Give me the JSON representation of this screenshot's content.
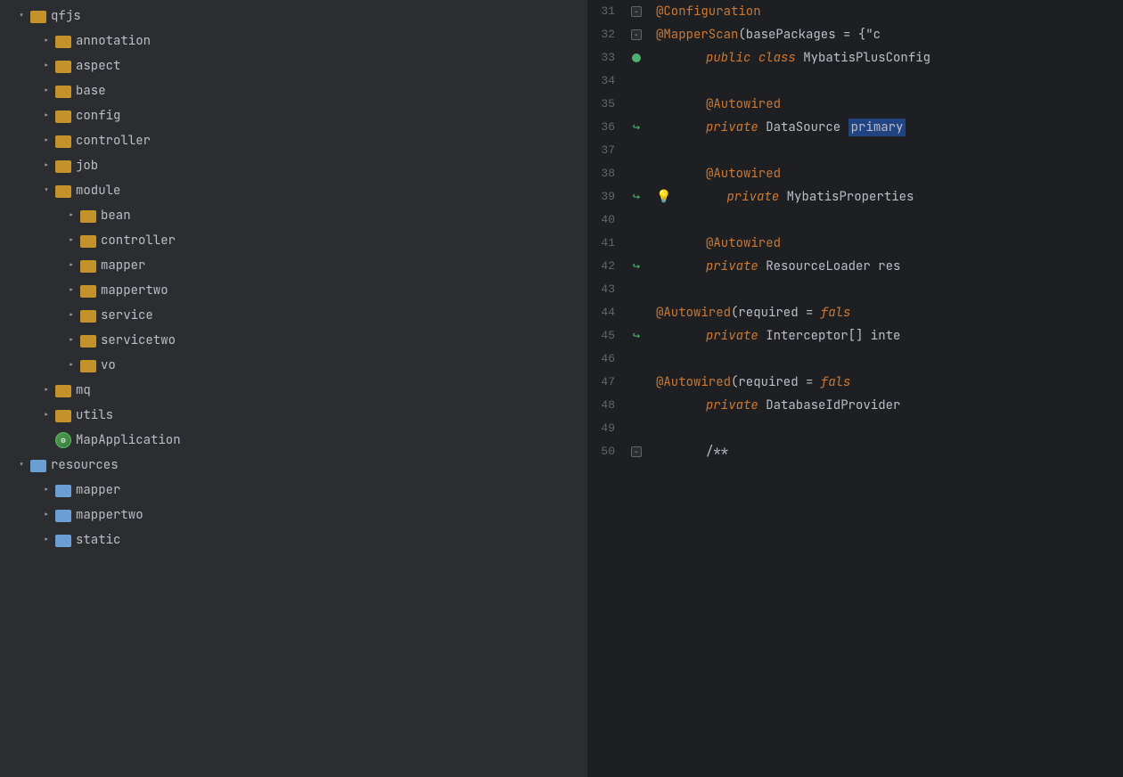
{
  "tree": {
    "items": [
      {
        "id": "qfjs",
        "label": "qfjs",
        "indent": 0,
        "chevron": "down",
        "icon": "folder",
        "level": 0
      },
      {
        "id": "annotation",
        "label": "annotation",
        "indent": 1,
        "chevron": "right",
        "icon": "folder",
        "level": 1
      },
      {
        "id": "aspect",
        "label": "aspect",
        "indent": 1,
        "chevron": "right",
        "icon": "folder",
        "level": 1
      },
      {
        "id": "base",
        "label": "base",
        "indent": 1,
        "chevron": "right",
        "icon": "folder",
        "level": 1
      },
      {
        "id": "config",
        "label": "config",
        "indent": 1,
        "chevron": "right",
        "icon": "folder",
        "level": 1
      },
      {
        "id": "controller",
        "label": "controller",
        "indent": 1,
        "chevron": "right",
        "icon": "folder",
        "level": 1
      },
      {
        "id": "job",
        "label": "job",
        "indent": 1,
        "chevron": "right",
        "icon": "folder",
        "level": 1
      },
      {
        "id": "module",
        "label": "module",
        "indent": 1,
        "chevron": "down",
        "icon": "folder",
        "level": 1
      },
      {
        "id": "bean",
        "label": "bean",
        "indent": 2,
        "chevron": "right",
        "icon": "folder",
        "level": 2
      },
      {
        "id": "m-controller",
        "label": "controller",
        "indent": 2,
        "chevron": "right",
        "icon": "folder",
        "level": 2
      },
      {
        "id": "mapper",
        "label": "mapper",
        "indent": 2,
        "chevron": "right",
        "icon": "folder",
        "level": 2
      },
      {
        "id": "mappertwo",
        "label": "mappertwo",
        "indent": 2,
        "chevron": "right",
        "icon": "folder",
        "level": 2
      },
      {
        "id": "service",
        "label": "service",
        "indent": 2,
        "chevron": "right",
        "icon": "folder",
        "level": 2
      },
      {
        "id": "servicetwo",
        "label": "servicetwo",
        "indent": 2,
        "chevron": "right",
        "icon": "folder",
        "level": 2
      },
      {
        "id": "vo",
        "label": "vo",
        "indent": 2,
        "chevron": "right",
        "icon": "folder",
        "level": 2
      },
      {
        "id": "mq",
        "label": "mq",
        "indent": 1,
        "chevron": "right",
        "icon": "folder",
        "level": 1
      },
      {
        "id": "utils",
        "label": "utils",
        "indent": 1,
        "chevron": "right",
        "icon": "folder",
        "level": 1
      },
      {
        "id": "MapApplication",
        "label": "MapApplication",
        "indent": 1,
        "chevron": "none",
        "icon": "app",
        "level": 1
      },
      {
        "id": "resources",
        "label": "resources",
        "indent": 0,
        "chevron": "down",
        "icon": "resources",
        "level": 0
      },
      {
        "id": "r-mapper",
        "label": "mapper",
        "indent": 1,
        "chevron": "right",
        "icon": "resources",
        "level": 1
      },
      {
        "id": "r-mappertwo",
        "label": "mappertwo",
        "indent": 1,
        "chevron": "right",
        "icon": "resources",
        "level": 1
      },
      {
        "id": "r-static",
        "label": "static",
        "indent": 1,
        "chevron": "right",
        "icon": "resources",
        "level": 1
      }
    ]
  },
  "code": {
    "lines": [
      {
        "num": 31,
        "gutter": "fold-minus",
        "git": "none",
        "tokens": [
          {
            "type": "annotation",
            "text": "@Configuration"
          }
        ]
      },
      {
        "num": 32,
        "gutter": "fold-minus",
        "git": "none",
        "tokens": [
          {
            "type": "annotation",
            "text": "@MapperScan"
          },
          {
            "type": "plain",
            "text": "(basePackages = {\"c"
          }
        ]
      },
      {
        "num": 33,
        "gutter": "none",
        "git": "green-circle",
        "tokens": [
          {
            "type": "kw-public",
            "text": "public"
          },
          {
            "type": "plain",
            "text": " "
          },
          {
            "type": "kw-class",
            "text": "class"
          },
          {
            "type": "plain",
            "text": " "
          },
          {
            "type": "classname",
            "text": "MybatisPlusConfig"
          }
        ]
      },
      {
        "num": 34,
        "gutter": "none",
        "git": "none",
        "tokens": []
      },
      {
        "num": 35,
        "gutter": "none",
        "git": "none",
        "tokens": [
          {
            "type": "annotation",
            "text": "@Autowired"
          }
        ]
      },
      {
        "num": 36,
        "gutter": "none",
        "git": "green-arrow",
        "tokens": [
          {
            "type": "kw-private",
            "text": "private"
          },
          {
            "type": "plain",
            "text": " DataSource "
          },
          {
            "type": "highlight",
            "text": "primary"
          }
        ]
      },
      {
        "num": 37,
        "gutter": "none",
        "git": "none",
        "tokens": []
      },
      {
        "num": 38,
        "gutter": "none",
        "git": "none",
        "tokens": [
          {
            "type": "annotation",
            "text": "@Autowired"
          }
        ]
      },
      {
        "num": 39,
        "gutter": "none",
        "git": "green-arrow",
        "tokens": [
          {
            "type": "kw-private",
            "text": "private"
          },
          {
            "type": "plain",
            "text": " MybatisProperties "
          }
        ],
        "hasBulb": true
      },
      {
        "num": 40,
        "gutter": "none",
        "git": "none",
        "tokens": []
      },
      {
        "num": 41,
        "gutter": "none",
        "git": "none",
        "tokens": [
          {
            "type": "annotation",
            "text": "@Autowired"
          }
        ]
      },
      {
        "num": 42,
        "gutter": "none",
        "git": "green-arrow",
        "tokens": [
          {
            "type": "kw-private",
            "text": "private"
          },
          {
            "type": "plain",
            "text": " ResourceLoader res"
          }
        ]
      },
      {
        "num": 43,
        "gutter": "none",
        "git": "none",
        "tokens": []
      },
      {
        "num": 44,
        "gutter": "none",
        "git": "none",
        "tokens": [
          {
            "type": "annotation",
            "text": "@Autowired"
          },
          {
            "type": "plain",
            "text": "(required = "
          },
          {
            "type": "kw-public",
            "text": "fals"
          }
        ]
      },
      {
        "num": 45,
        "gutter": "none",
        "git": "green-arrow",
        "tokens": [
          {
            "type": "kw-private",
            "text": "private"
          },
          {
            "type": "plain",
            "text": " Interceptor[] inte"
          }
        ]
      },
      {
        "num": 46,
        "gutter": "none",
        "git": "none",
        "tokens": []
      },
      {
        "num": 47,
        "gutter": "none",
        "git": "none",
        "tokens": [
          {
            "type": "annotation",
            "text": "@Autowired"
          },
          {
            "type": "plain",
            "text": "(required = "
          },
          {
            "type": "kw-public",
            "text": "fals"
          }
        ]
      },
      {
        "num": 48,
        "gutter": "none",
        "git": "none",
        "tokens": [
          {
            "type": "kw-private",
            "text": "private"
          },
          {
            "type": "plain",
            "text": " DatabaseIdProvider"
          }
        ]
      },
      {
        "num": 49,
        "gutter": "none",
        "git": "none",
        "tokens": []
      },
      {
        "num": 50,
        "gutter": "fold-minus",
        "git": "none",
        "tokens": [
          {
            "type": "plain",
            "text": "/**"
          }
        ]
      }
    ]
  }
}
